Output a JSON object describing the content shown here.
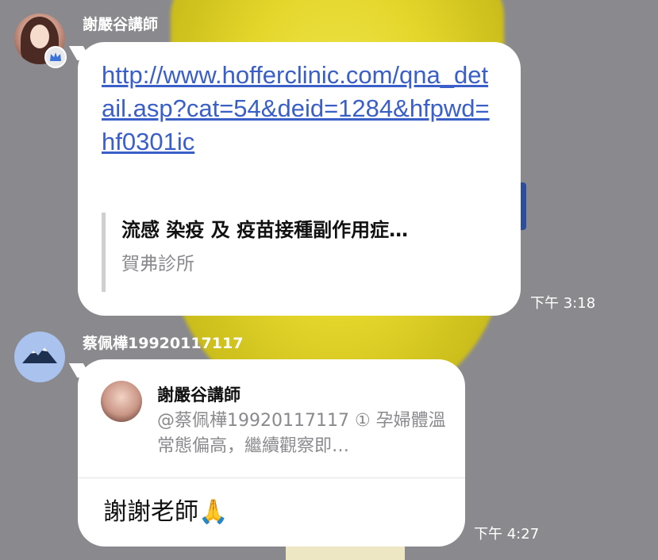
{
  "messages": [
    {
      "sender": "謝嚴谷講師",
      "link": "http://www.hofferclinic.com/qna_detail.asp?cat=54&deid=1284&hfpwd=hf0301ic",
      "preview_title": "流感 染疫 及 疫苗接種副作用症…",
      "preview_site": "賀弗診所",
      "time": "下午 3:18"
    },
    {
      "sender": "蔡佩樺19920117117",
      "reply_to_name": "謝嚴谷講師",
      "reply_to_text": "@蔡佩樺19920117117 ① 孕婦體溫常態偏高，繼續觀察即…",
      "text": "謝謝老師🙏",
      "time": "下午 4:27"
    }
  ],
  "icons": {
    "crown_badge": "crown-icon",
    "user_avatar": "mountain-icon"
  },
  "colors": {
    "background": "#8a8a8e",
    "link": "#3a5fc6",
    "bubble": "#ffffff",
    "secondary_text": "#8a8a8e"
  }
}
